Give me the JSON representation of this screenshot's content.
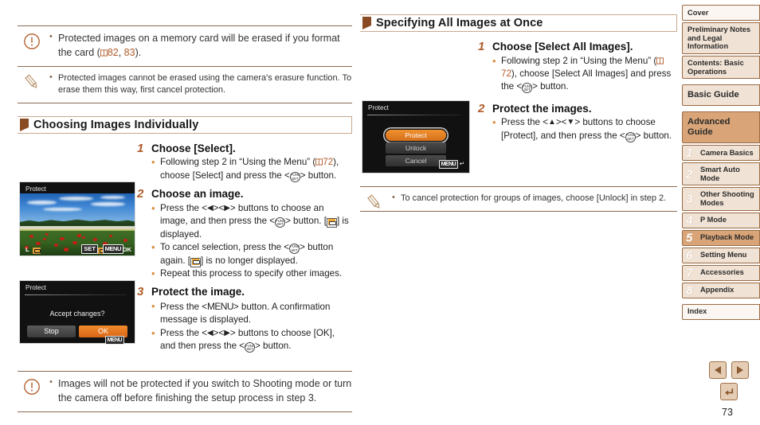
{
  "page_number": "73",
  "colors": {
    "accent_brown": "#8a4b24",
    "link_orange": "#b05a28",
    "bullet_orange": "#d98f3f",
    "tab_fill": "#f0e2d4",
    "tab_active": "#d9a578",
    "tab_border": "#9a6b45",
    "camera_highlight": "#f0912e"
  },
  "left_column": {
    "warning_note": {
      "icon": "exclamation-circle-icon",
      "items": [
        {
          "pre": "Protected images on a memory card will be erased if you format the card (",
          "book_icon": "book-icon",
          "page_a": "82",
          "sep": ", ",
          "page_b": "83",
          "post": ")."
        }
      ]
    },
    "pencil_note": {
      "icon": "pencil-icon",
      "text": "Protected images cannot be erased using the camera's erasure function. To erase them this way, first cancel protection."
    },
    "section_title": "Choosing Images Individually",
    "steps": [
      {
        "number": "1",
        "title": "Choose [Select].",
        "bullets": [
          {
            "parts": [
              "Following step 2 in “Using the Menu” (",
              "BOOK",
              "72",
              "), choose [Select] and press the <",
              "FUNC",
              "> button."
            ]
          }
        ]
      },
      {
        "number": "2",
        "title": "Choose an image.",
        "bullets": [
          {
            "parts": [
              "Press the <",
              "LEFT",
              "><",
              "RIGHT",
              "> buttons to choose an image, and then press the <",
              "FUNC",
              "> button. [",
              "LOCK",
              "] is displayed."
            ]
          },
          {
            "parts": [
              "To cancel selection, press the <",
              "FUNC",
              "> button again. [",
              "LOCK",
              "] is no longer displayed."
            ]
          },
          {
            "parts": [
              "Repeat this process to specify other images."
            ]
          }
        ]
      },
      {
        "number": "3",
        "title": "Protect the image.",
        "bullets": [
          {
            "parts": [
              "Press the <",
              "MENU",
              "> button. A confirmation message is displayed."
            ]
          },
          {
            "parts": [
              "Press the <",
              "LEFT",
              "><",
              "RIGHT",
              "> buttons to choose [OK], and then press the <",
              "FUNC",
              "> button."
            ]
          }
        ]
      }
    ],
    "screenshot_photo": {
      "title": "Protect",
      "quality_badge": "L",
      "lock_badge": "lock-icon",
      "set_badge": "SET",
      "set_action": "lock-icon",
      "menu_badge": "MENU",
      "menu_action": "OK"
    },
    "screenshot_confirm": {
      "title": "Protect",
      "message": "Accept changes?",
      "buttons": [
        "Stop",
        "OK"
      ],
      "selected_button": "OK",
      "menu_badge": "MENU",
      "menu_action": "return-arrow-icon"
    },
    "bottom_warning": {
      "icon": "exclamation-circle-icon",
      "text": "Images will not be protected if you switch to Shooting mode or turn the camera off before finishing the setup process in step 3."
    }
  },
  "right_column": {
    "section_title": "Specifying All Images at Once",
    "steps": [
      {
        "number": "1",
        "title": "Choose [Select All Images].",
        "bullets": [
          {
            "parts": [
              "Following step 2 in “Using the Menu” (",
              "BOOK",
              "72",
              "), choose [Select All Images] and press the <",
              "FUNC",
              "> button."
            ]
          }
        ]
      },
      {
        "number": "2",
        "title": "Protect the images.",
        "bullets": [
          {
            "parts": [
              "Press the <",
              "UP",
              "><",
              "DOWN",
              "> buttons to choose [Protect], and then press the <",
              "FUNC",
              "> button."
            ]
          }
        ]
      }
    ],
    "screenshot_menu": {
      "title": "Protect",
      "options": [
        "Protect",
        "Unlock",
        "Cancel"
      ],
      "selected_option": "Protect",
      "menu_badge": "MENU",
      "menu_action": "return-arrow-icon"
    },
    "pencil_note": {
      "icon": "pencil-icon",
      "text": "To cancel protection for groups of images, choose [Unlock] in step 2."
    }
  },
  "sidebar": {
    "tabs": [
      {
        "label": "Cover",
        "style": "plain",
        "number": null,
        "active": false
      },
      {
        "label": "Preliminary Notes and Legal Information",
        "style": "small",
        "number": null,
        "active": false
      },
      {
        "label": "Contents: Basic Operations",
        "style": "small",
        "number": null,
        "active": false
      },
      {
        "label": "Basic Guide",
        "style": "big",
        "number": null,
        "active": false
      },
      {
        "label": "Advanced Guide",
        "style": "big",
        "number": null,
        "active": true
      },
      {
        "label": "Camera Basics",
        "style": "small",
        "number": "1",
        "active": false
      },
      {
        "label": "Smart Auto Mode",
        "style": "small",
        "number": "2",
        "active": false
      },
      {
        "label": "Other Shooting Modes",
        "style": "small",
        "number": "3",
        "active": false
      },
      {
        "label": "P Mode",
        "style": "small",
        "number": "4",
        "active": false
      },
      {
        "label": "Playback Mode",
        "style": "small",
        "number": "5",
        "active": true
      },
      {
        "label": "Setting Menu",
        "style": "small",
        "number": "6",
        "active": false
      },
      {
        "label": "Accessories",
        "style": "small",
        "number": "7",
        "active": false
      },
      {
        "label": "Appendix",
        "style": "small",
        "number": "8",
        "active": false
      },
      {
        "label": "Index",
        "style": "plain",
        "number": null,
        "active": false
      }
    ]
  },
  "nav": {
    "prev": "previous-page-arrow",
    "next": "next-page-arrow",
    "back": "return-arrow"
  }
}
